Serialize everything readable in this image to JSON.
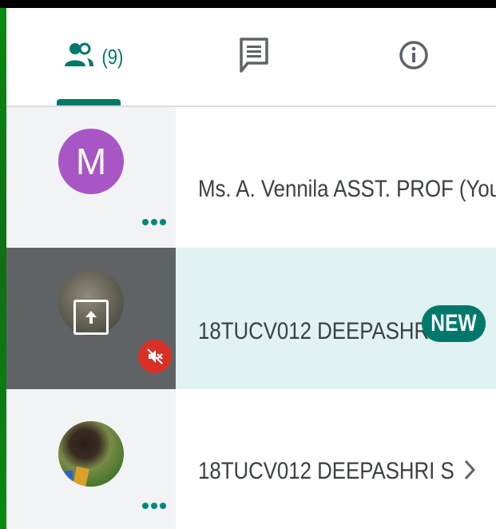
{
  "tabs": {
    "people_count": "(9)",
    "people_icon": "people-icon",
    "chat_icon": "chat-icon",
    "info_icon": "info-icon",
    "active": "people"
  },
  "participants": [
    {
      "avatar_letter": "M",
      "avatar_color": "#a855c6",
      "name": "Ms. A. Vennila ASST. PROF (You)",
      "has_menu_dots": true
    },
    {
      "name": "18TUCV012 DEEPASHR...",
      "badge": "NEW",
      "icons": [
        "upload-icon",
        "mic-off-icon"
      ],
      "highlighted": true
    },
    {
      "name": "18TUCV012 DEEPASHRI S",
      "has_menu_dots": true,
      "icons": [
        "chevron-right-icon"
      ]
    }
  ],
  "colors": {
    "accent": "#00796b",
    "highlight_row": "#e0f2f1",
    "mute_badge": "#d93025",
    "dots": "#00897b"
  }
}
